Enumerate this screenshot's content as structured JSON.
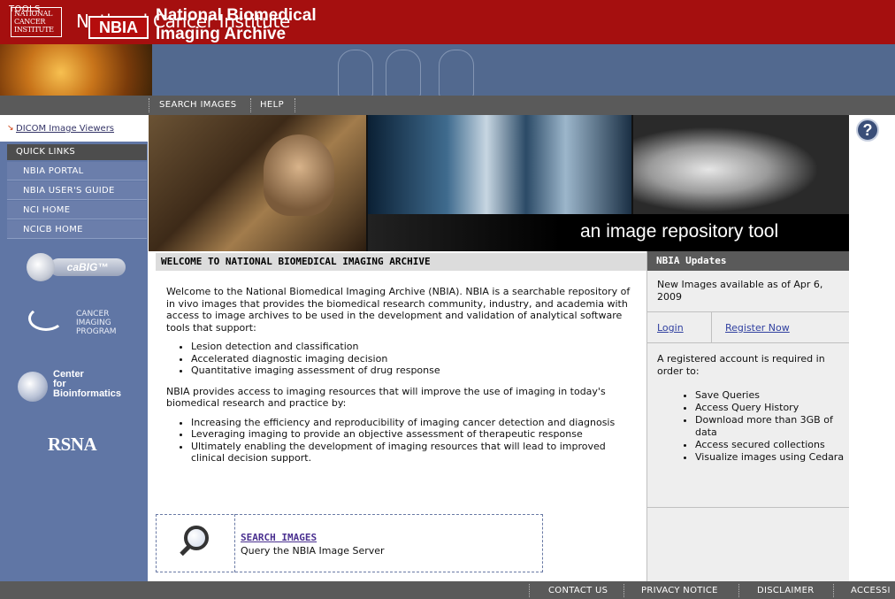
{
  "header": {
    "logo_text": "NATIONAL CANCER INSTITUTE",
    "title": "National Cancer Institute"
  },
  "banner": {
    "badge": "NBIA",
    "title_line1": "National Biomedical",
    "title_line2": "Imaging Archive"
  },
  "nav": {
    "tools_label": "TOOLS",
    "items": [
      {
        "label": "SEARCH IMAGES"
      },
      {
        "label": "HELP"
      }
    ]
  },
  "sidebar": {
    "tool_link": "DICOM Image Viewers",
    "quick_links_label": "QUICK LINKS",
    "quick_links": [
      {
        "label": "NBIA PORTAL"
      },
      {
        "label": "NBIA USER'S GUIDE"
      },
      {
        "label": "NCI HOME"
      },
      {
        "label": "NCICB HOME"
      }
    ],
    "logos": {
      "cabig": "caBIG™",
      "cip": "CANCER\nIMAGING\nPROGRAM",
      "cbiit": "Center\nfor\nBioinformatics",
      "rsna": "RSNA"
    }
  },
  "hero": {
    "tagline": "an image repository tool"
  },
  "welcome": {
    "heading": "WELCOME TO NATIONAL BIOMEDICAL IMAGING ARCHIVE",
    "intro": "Welcome to the National Biomedical Imaging Archive (NBIA). NBIA is a searchable repository of in vivo images that provides the biomedical research community, industry, and academia with access to image archives to be used in the development and validation of analytical software tools that support:",
    "bullets1": [
      "Lesion detection and classification",
      "Accelerated diagnostic imaging decision",
      "Quantitative imaging assessment of drug response"
    ],
    "para2": "NBIA provides access to imaging resources that will improve the use of imaging in today's biomedical research and practice by:",
    "bullets2": [
      "Increasing the efficiency and reproducibility of imaging cancer detection and diagnosis",
      "Leveraging imaging to provide an objective assessment of therapeutic response",
      "Ultimately enabling the development of imaging resources that will lead to improved clinical decision support."
    ],
    "search_link": "SEARCH IMAGES",
    "search_desc": "Query the NBIA Image Server"
  },
  "updates": {
    "heading": "NBIA Updates",
    "news": "New Images available as of Apr 6, 2009",
    "login": "Login",
    "register": "Register Now",
    "account_text": "A registered account is required in order to:",
    "benefits": [
      "Save Queries",
      "Access Query History",
      "Download more than 3GB of data",
      "Access secured collections",
      "Visualize images using Cedara"
    ]
  },
  "help_icon": "?",
  "footer": {
    "links": [
      {
        "label": "CONTACT US"
      },
      {
        "label": "PRIVACY NOTICE"
      },
      {
        "label": "DISCLAIMER"
      },
      {
        "label": "ACCESSI"
      }
    ]
  },
  "colors": {
    "nci_red": "#a50f0f",
    "banner_blue": "#52698f",
    "sidebar_blue": "#6076a5",
    "nav_gray": "#5a5a5a"
  }
}
